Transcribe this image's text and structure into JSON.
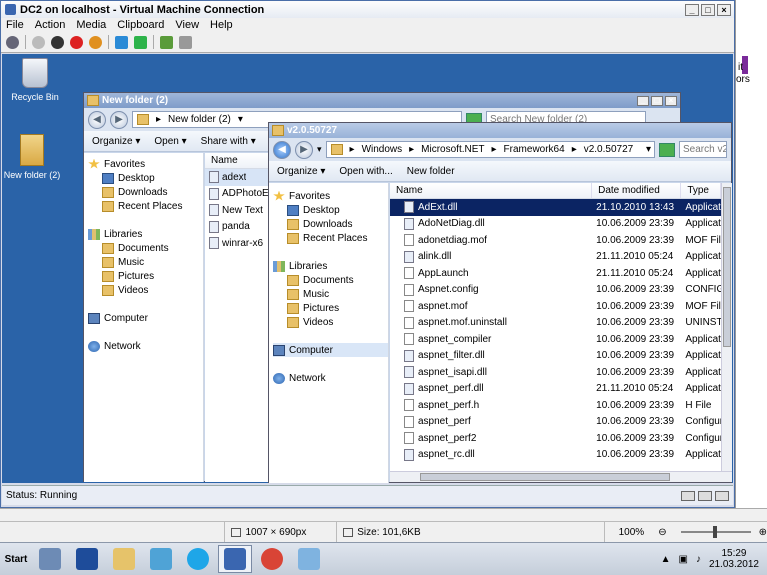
{
  "vm": {
    "title": "DC2 on localhost - Virtual Machine Connection",
    "menu": [
      "File",
      "Action",
      "Media",
      "Clipboard",
      "View",
      "Help"
    ],
    "status": "Status: Running"
  },
  "desktop": {
    "icons": [
      {
        "label": "Recycle Bin",
        "icon": "recycle-bin-icon"
      },
      {
        "label": "New folder (2)",
        "icon": "folder-icon"
      }
    ]
  },
  "back_explorer": {
    "title": "New folder (2)",
    "address_crumb": "New folder (2)",
    "search_placeholder": "Search New folder (2)",
    "commands": [
      "Organize",
      "Open",
      "Share with"
    ],
    "nav": [
      {
        "label": "Favorites",
        "kind": "fav",
        "indent": 0
      },
      {
        "label": "Desktop",
        "kind": "blue",
        "indent": 1
      },
      {
        "label": "Downloads",
        "kind": "folder",
        "indent": 1
      },
      {
        "label": "Recent Places",
        "kind": "folder",
        "indent": 1
      },
      {
        "label": "",
        "kind": "gap",
        "indent": 0
      },
      {
        "label": "Libraries",
        "kind": "lib",
        "indent": 0
      },
      {
        "label": "Documents",
        "kind": "folder",
        "indent": 1
      },
      {
        "label": "Music",
        "kind": "folder",
        "indent": 1
      },
      {
        "label": "Pictures",
        "kind": "folder",
        "indent": 1
      },
      {
        "label": "Videos",
        "kind": "folder",
        "indent": 1
      },
      {
        "label": "",
        "kind": "gap",
        "indent": 0
      },
      {
        "label": "Computer",
        "kind": "comp",
        "indent": 0
      },
      {
        "label": "",
        "kind": "gap",
        "indent": 0
      },
      {
        "label": "Network",
        "kind": "net",
        "indent": 0
      }
    ],
    "list_header": "Name",
    "files": [
      "adext",
      "ADPhotoE",
      "New Text",
      "panda",
      "winrar-x6"
    ]
  },
  "front_explorer": {
    "title": "v2.0.50727",
    "breadcrumb": [
      "Windows",
      "Microsoft.NET",
      "Framework64",
      "v2.0.50727"
    ],
    "search_placeholder": "Search v2...",
    "commands": [
      "Organize",
      "Open with...",
      "New folder"
    ],
    "nav": [
      {
        "label": "Favorites",
        "kind": "fav",
        "indent": 0
      },
      {
        "label": "Desktop",
        "kind": "blue",
        "indent": 1
      },
      {
        "label": "Downloads",
        "kind": "folder",
        "indent": 1
      },
      {
        "label": "Recent Places",
        "kind": "folder",
        "indent": 1
      },
      {
        "label": "",
        "kind": "gap",
        "indent": 0
      },
      {
        "label": "Libraries",
        "kind": "lib",
        "indent": 0
      },
      {
        "label": "Documents",
        "kind": "folder",
        "indent": 1
      },
      {
        "label": "Music",
        "kind": "folder",
        "indent": 1
      },
      {
        "label": "Pictures",
        "kind": "folder",
        "indent": 1
      },
      {
        "label": "Videos",
        "kind": "folder",
        "indent": 1
      },
      {
        "label": "",
        "kind": "gap",
        "indent": 0
      },
      {
        "label": "Computer",
        "kind": "comp",
        "indent": 0
      },
      {
        "label": "",
        "kind": "gap",
        "indent": 0
      },
      {
        "label": "Network",
        "kind": "net",
        "indent": 0
      }
    ],
    "columns": {
      "name": "Name",
      "date": "Date modified",
      "type": "Type"
    },
    "files": [
      {
        "name": "AdExt.dll",
        "date": "21.10.2010 13:43",
        "type": "Applicatio",
        "selected": true
      },
      {
        "name": "AdoNetDiag.dll",
        "date": "10.06.2009 23:39",
        "type": "Applicatio"
      },
      {
        "name": "adonetdiag.mof",
        "date": "10.06.2009 23:39",
        "type": "MOF File"
      },
      {
        "name": "alink.dll",
        "date": "21.11.2010 05:24",
        "type": "Applicatio"
      },
      {
        "name": "AppLaunch",
        "date": "21.11.2010 05:24",
        "type": "Applicatio"
      },
      {
        "name": "Aspnet.config",
        "date": "10.06.2009 23:39",
        "type": "CONFIG Fi"
      },
      {
        "name": "aspnet.mof",
        "date": "10.06.2009 23:39",
        "type": "MOF File"
      },
      {
        "name": "aspnet.mof.uninstall",
        "date": "10.06.2009 23:39",
        "type": "UNINSTAL"
      },
      {
        "name": "aspnet_compiler",
        "date": "10.06.2009 23:39",
        "type": "Applicatio"
      },
      {
        "name": "aspnet_filter.dll",
        "date": "10.06.2009 23:39",
        "type": "Applicatio"
      },
      {
        "name": "aspnet_isapi.dll",
        "date": "10.06.2009 23:39",
        "type": "Applicatio"
      },
      {
        "name": "aspnet_perf.dll",
        "date": "21.11.2010 05:24",
        "type": "Applicatio"
      },
      {
        "name": "aspnet_perf.h",
        "date": "10.06.2009 23:39",
        "type": "H File"
      },
      {
        "name": "aspnet_perf",
        "date": "10.06.2009 23:39",
        "type": "Configura"
      },
      {
        "name": "aspnet_perf2",
        "date": "10.06.2009 23:39",
        "type": "Configura"
      },
      {
        "name": "aspnet_rc.dll",
        "date": "10.06.2009 23:39",
        "type": "Applicatio"
      }
    ]
  },
  "image_viewer_status": {
    "dimensions": "1007 × 690px",
    "size": "Size: 101,6KB",
    "zoom": "100%"
  },
  "taskbar": {
    "start_label": "Start",
    "apps": [
      {
        "name": "server-manager",
        "color": "#6d8bb5"
      },
      {
        "name": "powershell",
        "color": "#1e4c9a"
      },
      {
        "name": "explorer",
        "color": "#e6c36a"
      },
      {
        "name": "tools",
        "color": "#4fa3d6"
      },
      {
        "name": "skype",
        "color": "#1ea6e8"
      },
      {
        "name": "vm-connection",
        "color": "#3a66b0"
      },
      {
        "name": "chrome",
        "color": "#d94436"
      },
      {
        "name": "paint",
        "color": "#7fb3e0"
      }
    ],
    "time": "15:29",
    "date": "21.03.2012"
  },
  "right_edge_text": [
    "it",
    "ors"
  ]
}
